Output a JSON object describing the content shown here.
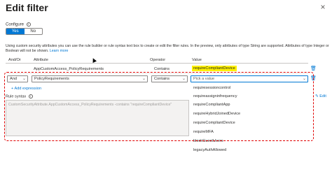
{
  "panel": {
    "title": "Edit filter",
    "close_glyph": "×"
  },
  "configure": {
    "label": "Configure",
    "info_glyph": "i",
    "options": [
      "Yes",
      "No"
    ],
    "selected": "Yes"
  },
  "description": {
    "text": "Using custom security attributes you can use the rule builder or rule syntax text box to create or edit the filter rules. In the preview, only attributes of type String are supported. Attributes of type Integer or Boolean will not be shown.",
    "link": "Learn more"
  },
  "grid": {
    "headers": [
      "And/Or",
      "Attribute",
      "Operator",
      "Value"
    ],
    "rows": [
      {
        "andor": "",
        "attribute": "AppCustomAccess_PolicyRequirements",
        "operator": "Contains",
        "value": "requireCompliantDevice"
      }
    ],
    "edit_row": {
      "andor": "And",
      "attribute": "PolicyRequirements",
      "operator": "Contains",
      "value_placeholder": "Pick a value"
    }
  },
  "add_expression": "+ Add expression",
  "rule_syntax": {
    "label": "Rule syntax",
    "info_glyph": "i",
    "edit": "Edit",
    "text": "CustomSecurityAttribute.AppCustomAccess_PolicyRequirements -contains \"requireCompliantDevice\""
  },
  "value_options": [
    "requiresessioncontrol",
    "requireassigninfrequency",
    "requireCompliantApp",
    "requireHybridJoinedDevice",
    "requireCompliantDevice",
    "requireMFA",
    "blockGuestUsers",
    "legacyAuthAllowed"
  ],
  "icons": {
    "close": "close-icon",
    "delete": "trash-icon",
    "chevron": "chevron-down-icon"
  },
  "colors": {
    "accent": "#0078d4",
    "highlight": "#fff200",
    "annotation": "#e00000"
  }
}
